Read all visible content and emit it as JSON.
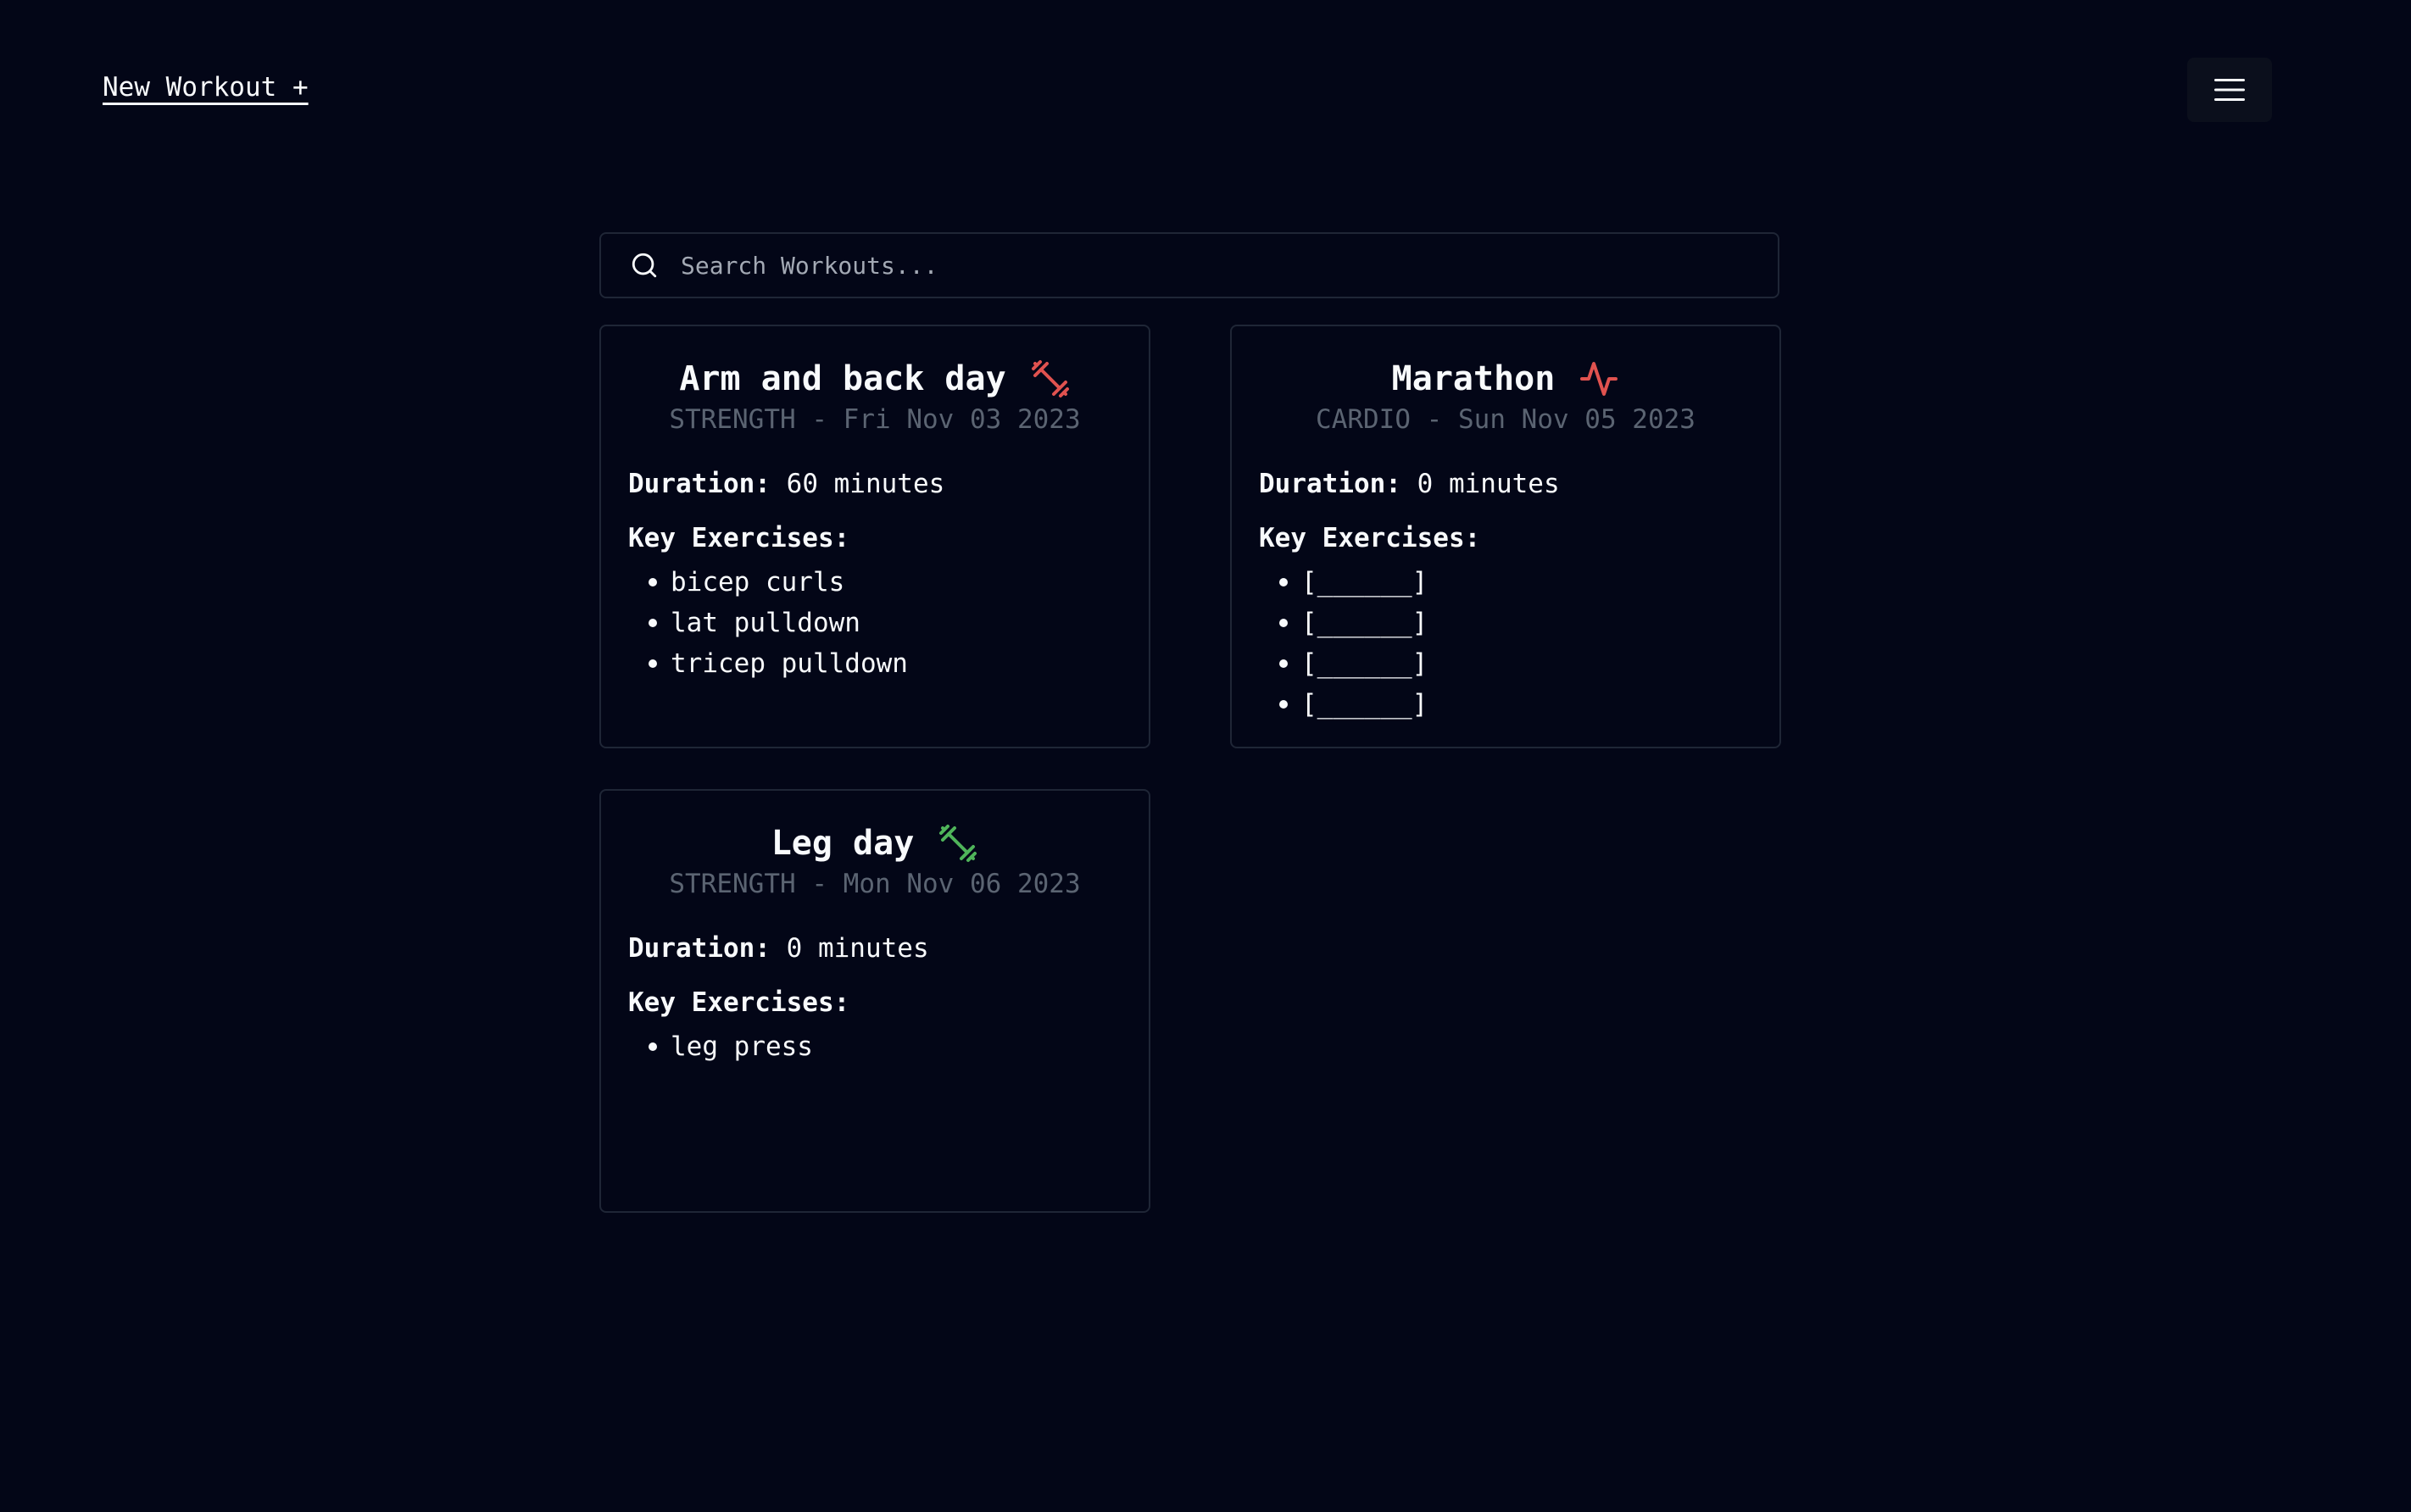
{
  "header": {
    "new_workout_label": "New Workout +",
    "menu_icon": "hamburger-menu-icon"
  },
  "search": {
    "placeholder": "Search Workouts...",
    "value": "",
    "icon": "search-icon"
  },
  "workouts": [
    {
      "title": "Arm and back day",
      "icon": "dumbbell-icon",
      "icon_color": "#e0524f",
      "subtitle": "STRENGTH - Fri Nov 03 2023",
      "duration_label": "Duration:",
      "duration_value": "60 minutes",
      "exercises_label": "Key Exercises:",
      "exercises": [
        "bicep curls",
        "lat pulldown",
        "tricep pulldown"
      ]
    },
    {
      "title": "Marathon",
      "icon": "activity-pulse-icon",
      "icon_color": "#e0524f",
      "subtitle": "CARDIO - Sun Nov 05 2023",
      "duration_label": "Duration:",
      "duration_value": "0 minutes",
      "exercises_label": "Key Exercises:",
      "exercises": [
        "[______]",
        "[______]",
        "[______]",
        "[______]"
      ]
    },
    {
      "title": "Leg day",
      "icon": "dumbbell-icon",
      "icon_color": "#4fb45a",
      "subtitle": "STRENGTH - Mon Nov 06 2023",
      "duration_label": "Duration:",
      "duration_value": "0 minutes",
      "exercises_label": "Key Exercises:",
      "exercises": [
        "leg press"
      ]
    }
  ],
  "colors": {
    "background": "#030617",
    "card_border": "#1f2636",
    "text": "#f8fafc",
    "muted": "#5b6472",
    "strength_icon_red": "#e0524f",
    "strength_icon_green": "#4fb45a"
  }
}
